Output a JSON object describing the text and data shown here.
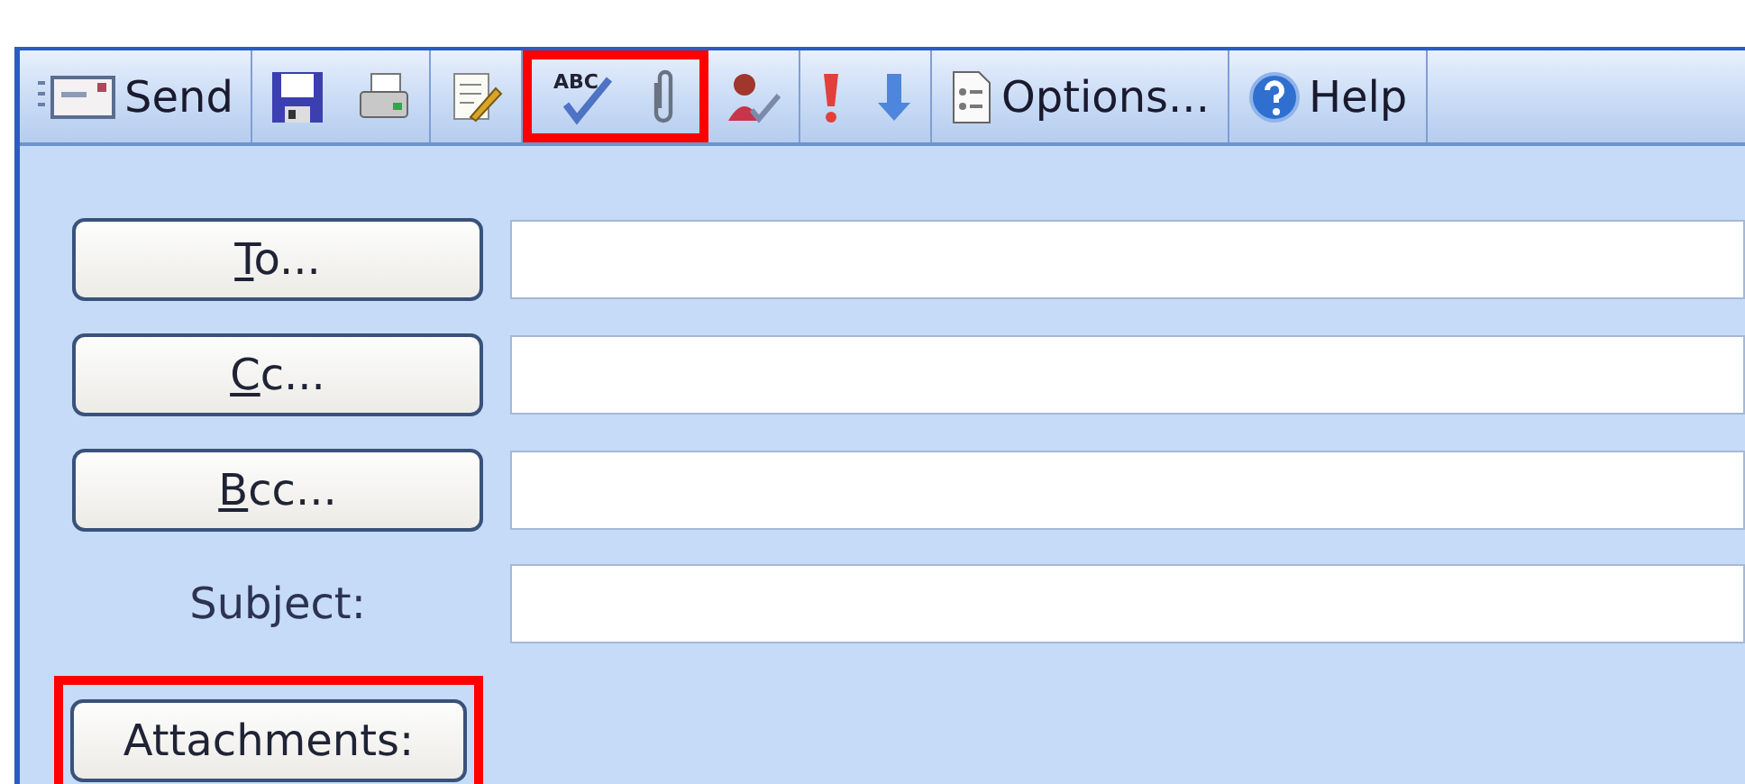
{
  "toolbar": {
    "groups": [
      {
        "highlighted": false,
        "items": [
          {
            "kind": "send",
            "label": "Send"
          }
        ]
      },
      {
        "highlighted": false,
        "items": [
          {
            "kind": "save"
          },
          {
            "kind": "print"
          }
        ]
      },
      {
        "highlighted": false,
        "items": [
          {
            "kind": "edit"
          }
        ]
      },
      {
        "highlighted": true,
        "items": [
          {
            "kind": "spelling",
            "icon_text": "ABC"
          },
          {
            "kind": "attach"
          }
        ]
      },
      {
        "highlighted": false,
        "items": [
          {
            "kind": "names"
          }
        ]
      },
      {
        "highlighted": false,
        "items": [
          {
            "kind": "high"
          },
          {
            "kind": "low"
          }
        ]
      },
      {
        "highlighted": false,
        "items": [
          {
            "kind": "options",
            "label": "Options..."
          }
        ]
      },
      {
        "highlighted": false,
        "items": [
          {
            "kind": "help",
            "label": "Help"
          }
        ]
      }
    ]
  },
  "fields": [
    {
      "kind": "button",
      "label": "To...",
      "underline_first": true
    },
    {
      "kind": "button",
      "label": "Cc...",
      "underline_first": true
    },
    {
      "kind": "button",
      "label": "Bcc...",
      "underline_first": true
    },
    {
      "kind": "label",
      "label": "Subject:"
    }
  ],
  "attachments": {
    "label": "Attachments:",
    "highlighted": true
  }
}
